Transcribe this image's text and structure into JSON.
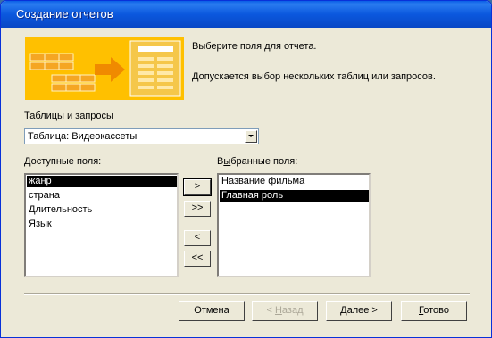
{
  "window": {
    "title": "Создание отчетов"
  },
  "intro": {
    "line1": "Выберите поля для отчета.",
    "line2": "Допускается выбор нескольких таблиц или запросов."
  },
  "source": {
    "label_mnemonic": "Т",
    "label_rest": "аблицы и запросы",
    "selected": "Таблица: Видеокассеты"
  },
  "available": {
    "label_mnemonic": "Д",
    "label_rest": "оступные поля:",
    "items": [
      "жанр",
      "страна",
      "Длительность",
      "Язык"
    ],
    "selected_item": "жанр"
  },
  "selected_fields": {
    "label_prefix": "В",
    "label_mnemonic": "ы",
    "label_rest": "бранные поля:",
    "items": [
      "Название фильма",
      "Главная роль"
    ],
    "selected_item": "Главная роль"
  },
  "transfer_buttons": {
    "add_one": ">",
    "add_all": ">>",
    "remove_one": "<",
    "remove_all": "<<"
  },
  "footer": {
    "cancel": "Отмена",
    "back_prefix": "< ",
    "back_mnemonic": "Н",
    "back_rest": "азад",
    "next_mnemonic": "Д",
    "next_rest": "алее >",
    "finish_mnemonic": "Г",
    "finish_rest": "отово"
  }
}
